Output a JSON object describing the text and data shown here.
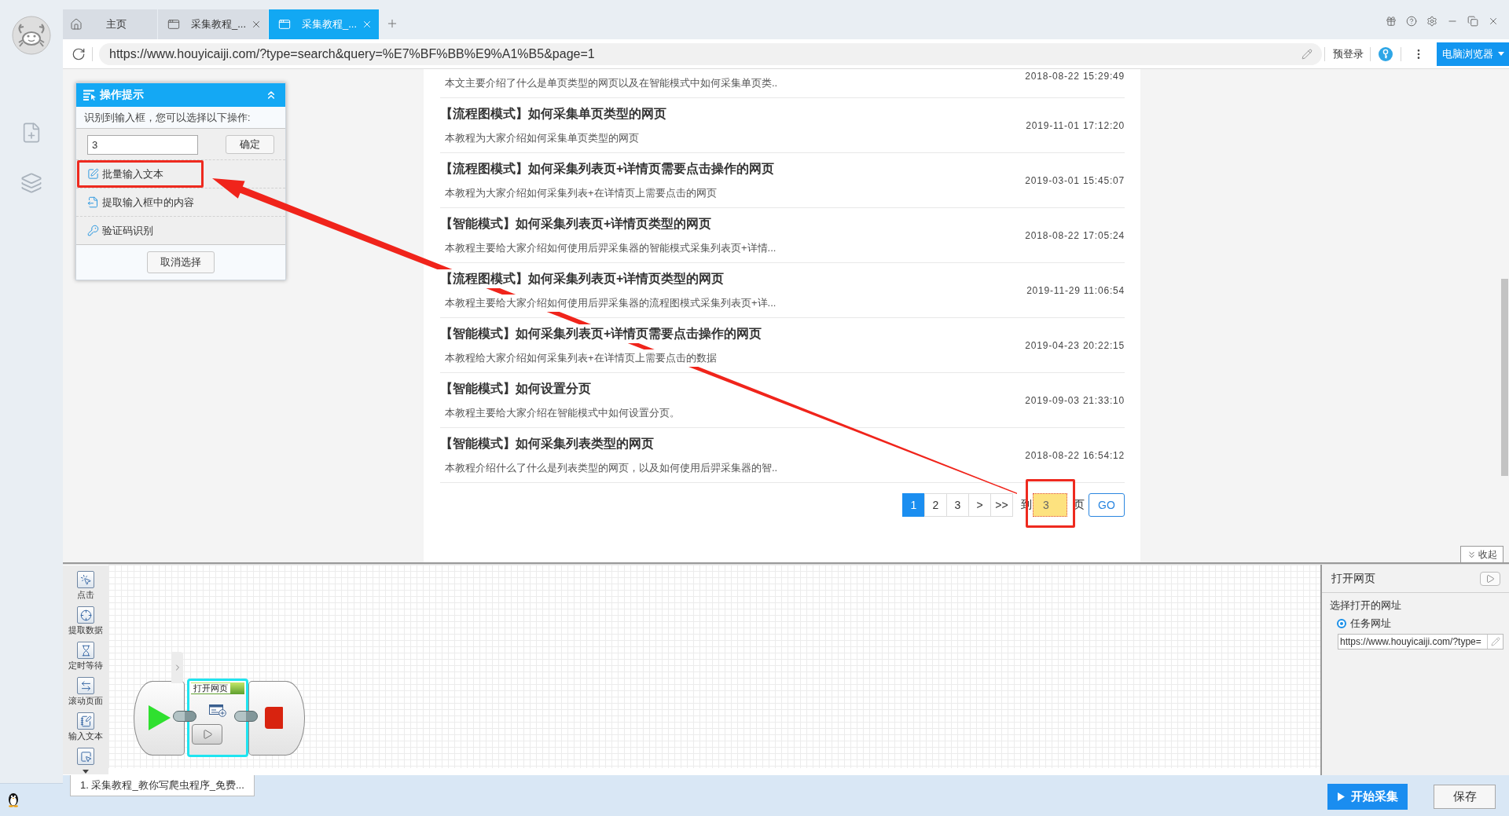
{
  "tabs": [
    {
      "kind": "home",
      "label": "主页",
      "selected": false
    },
    {
      "kind": "page",
      "label": "采集教程_...",
      "selected": false
    },
    {
      "kind": "page",
      "label": "采集教程_...",
      "selected": true
    }
  ],
  "address_bar": {
    "url": "https://www.houyicaiji.com/?type=search&query=%E7%BF%BB%E9%A1%B5&page=1",
    "login": "预登录",
    "mode_button": "电脑浏览器"
  },
  "page": {
    "results": [
      {
        "description": "本文主要介绍了什么是单页类型的网页以及在智能模式中如何采集单页类..",
        "date": "2018-08-22 15:29:49"
      },
      {
        "title": "【流程图模式】如何采集单页类型的网页",
        "description": "本教程为大家介绍如何采集单页类型的网页",
        "date": "2019-11-01 17:12:20"
      },
      {
        "title": "【流程图模式】如何采集列表页+详情页需要点击操作的网页",
        "description": "本教程为大家介绍如何采集列表+在详情页上需要点击的网页",
        "date": "2019-03-01 15:45:07"
      },
      {
        "title": "【智能模式】如何采集列表页+详情页类型的网页",
        "description": "本教程主要给大家介绍如何使用后羿采集器的智能模式采集列表页+详情...",
        "date": "2018-08-22 17:05:24"
      },
      {
        "title": "【流程图模式】如何采集列表页+详情页类型的网页",
        "description": "本教程主要给大家介绍如何使用后羿采集器的流程图模式采集列表页+详...",
        "date": "2019-11-29 11:06:54"
      },
      {
        "title": "【智能模式】如何采集列表页+详情页需要点击操作的网页",
        "description": "本教程给大家介绍如何采集列表+在详情页上需要点击的数据",
        "date": "2019-04-23 20:22:15"
      },
      {
        "title": "【智能模式】如何设置分页",
        "description": "本教程主要给大家介绍在智能模式中如何设置分页。",
        "date": "2019-09-03 21:33:10"
      },
      {
        "title": "【智能模式】如何采集列表类型的网页",
        "description": "本教程介绍什么了什么是列表类型的网页，以及如何使用后羿采集器的智..",
        "date": "2018-08-22 16:54:12"
      }
    ],
    "pagination": {
      "pages": [
        {
          "label": "1",
          "selected": true
        },
        {
          "label": "2",
          "selected": false
        },
        {
          "label": "3",
          "selected": false
        }
      ],
      "next": ">",
      "last": ">>",
      "goto_prefix": "到",
      "goto_value": "3",
      "goto_highlighted": true,
      "goto_annotated": true,
      "goto_suffix": "页",
      "go_button": "GO"
    }
  },
  "tip_panel": {
    "title": "操作提示",
    "message": "识别到输入框，您可以选择以下操作:",
    "input_value": "3",
    "confirm": "确定",
    "actions": [
      {
        "kind": "batch-input",
        "label": "批量输入文本",
        "annotated": true
      },
      {
        "kind": "extract",
        "label": "提取输入框中的内容",
        "annotated": false
      },
      {
        "kind": "captcha",
        "label": "验证码识别",
        "annotated": false
      }
    ],
    "cancel": "取消选择"
  },
  "collapse_button": "收起",
  "toolbox": {
    "items": [
      {
        "kind": "click",
        "label": "点击"
      },
      {
        "kind": "extract",
        "label": "提取数据"
      },
      {
        "kind": "wait",
        "label": "定时等待"
      },
      {
        "kind": "scroll",
        "label": "滚动页面"
      },
      {
        "kind": "input",
        "label": "输入文本"
      }
    ]
  },
  "workflow": {
    "nodes": [
      {
        "kind": "start"
      },
      {
        "kind": "action",
        "title": "打开网页",
        "selected": true
      },
      {
        "kind": "end"
      }
    ]
  },
  "properties": {
    "title": "打开网页",
    "section": "选择打开的网址",
    "options": [
      {
        "label": "任务网址",
        "selected": true
      }
    ],
    "url": "https://www.houyicaiji.com/?type="
  },
  "task_tabs": [
    {
      "label": "1. 采集教程_教你写爬虫程序_免费..."
    }
  ],
  "footer": {
    "start": "开始采集",
    "save": "保存"
  }
}
